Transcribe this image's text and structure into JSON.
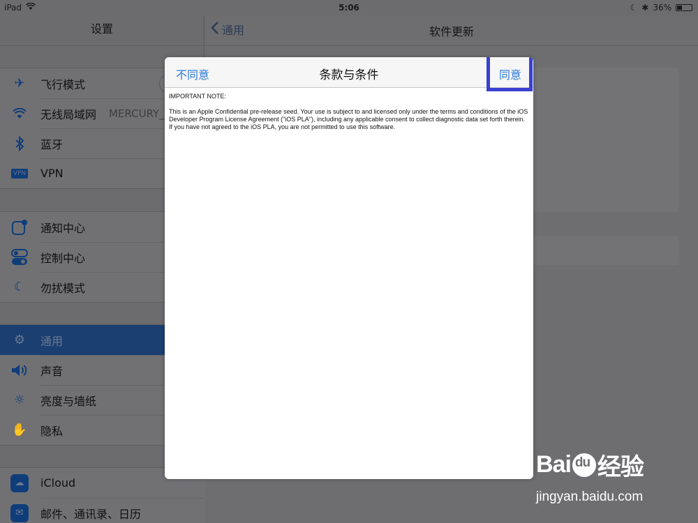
{
  "status_bar": {
    "device": "iPad",
    "time": "5:06",
    "battery": "36%",
    "battery_level": 0.36
  },
  "master": {
    "title": "设置",
    "groups": [
      [
        {
          "icon": "airplane-icon",
          "label": "飞行模式",
          "value": ""
        },
        {
          "icon": "wifi-icon",
          "label": "无线局域网",
          "value": "MERCURY_"
        },
        {
          "icon": "bluetooth-icon",
          "label": "蓝牙",
          "value": ""
        },
        {
          "icon": "vpn-icon",
          "label": "VPN",
          "value": ""
        }
      ],
      [
        {
          "icon": "notification-center-icon",
          "label": "通知中心",
          "value": ""
        },
        {
          "icon": "control-center-icon",
          "label": "控制中心",
          "value": ""
        },
        {
          "icon": "moon-icon",
          "label": "勿扰模式",
          "value": ""
        }
      ],
      [
        {
          "icon": "gear-icon",
          "label": "通用",
          "value": "",
          "selected": true
        },
        {
          "icon": "sound-icon",
          "label": "声音",
          "value": ""
        },
        {
          "icon": "brightness-icon",
          "label": "亮度与墙纸",
          "value": ""
        },
        {
          "icon": "privacy-hand-icon",
          "label": "隐私",
          "value": ""
        }
      ],
      [
        {
          "icon": "icloud-icon",
          "label": "iCloud",
          "value": ""
        },
        {
          "icon": "mail-icon",
          "label": "邮件、通讯录、日历",
          "value": ""
        }
      ]
    ]
  },
  "detail": {
    "back_label": "通用",
    "title": "软件更新"
  },
  "modal": {
    "disagree_label": "不同意",
    "title": "条款与条件",
    "agree_label": "同意",
    "body_heading": "IMPORTANT NOTE:",
    "body_text": "This is an Apple Confidential pre-release seed.  Your use is subject to and licensed only under the terms and conditions of the iOS Developer Program License Agreement (\"iOS PLA\"), including any applicable consent to collect diagnostic data set forth therein. If you have not agreed to the iOS PLA, you are not permitted to use this software."
  },
  "watermark": {
    "brand_left": "Bai",
    "brand_right": "经验",
    "url": "jingyan.baidu.com"
  },
  "colors": {
    "accent": "#2a7ad8",
    "highlight_box": "#3a3fd0"
  }
}
